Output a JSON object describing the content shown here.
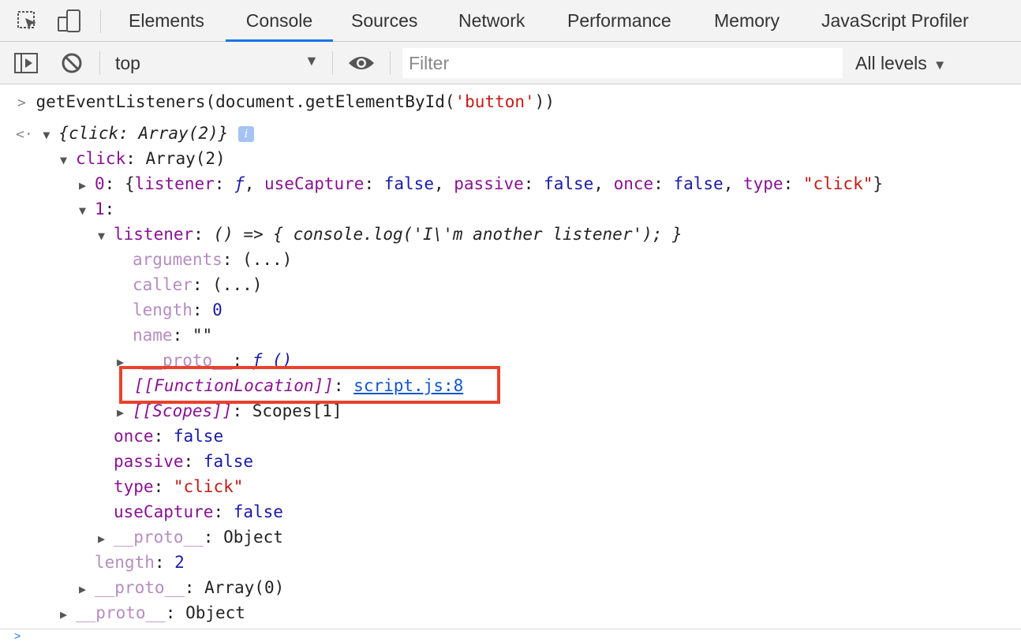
{
  "tabs": [
    {
      "label": "Elements"
    },
    {
      "label": "Console"
    },
    {
      "label": "Sources"
    },
    {
      "label": "Network"
    },
    {
      "label": "Performance"
    },
    {
      "label": "Memory"
    },
    {
      "label": "JavaScript Profiler"
    }
  ],
  "toolbar": {
    "context": "top",
    "filter_placeholder": "Filter",
    "levels": "All levels"
  },
  "console": {
    "input": {
      "fn": "getEventListeners",
      "args": "(document.getElementById(",
      "string": "'button'",
      "close": "))"
    },
    "result_summary": "{click: Array(2)}",
    "click_label": "click",
    "click_value": "Array(2)",
    "item0": {
      "index": "0",
      "open": "{",
      "listener_key": "listener",
      "listener_val": "ƒ",
      "usecapture_key": "useCapture",
      "usecapture_val": "false",
      "passive_key": "passive",
      "passive_val": "false",
      "once_key": "once",
      "once_val": "false",
      "type_key": "type",
      "type_val": "\"click\"",
      "close": "}"
    },
    "item1_index": "1",
    "listener_key": "listener",
    "listener_src": "() => { console.log('I\\'m another listener'); }",
    "fn_props": [
      {
        "key": "arguments",
        "val": "(...)"
      },
      {
        "key": "caller",
        "val": "(...)"
      },
      {
        "key": "length",
        "val": "0"
      },
      {
        "key": "name",
        "val": "\"\""
      }
    ],
    "fn_proto_key": "__proto__",
    "fn_proto_val": "ƒ ()",
    "function_location_key": "[[FunctionLocation]]",
    "function_location_link": "script.js:8",
    "scopes_key": "[[Scopes]]",
    "scopes_val": "Scopes[1]",
    "item1_props": [
      {
        "key": "once",
        "val": "false"
      },
      {
        "key": "passive",
        "val": "false"
      },
      {
        "key": "type",
        "val": "\"click\""
      },
      {
        "key": "useCapture",
        "val": "false"
      }
    ],
    "item1_proto_key": "__proto__",
    "item1_proto_val": "Object",
    "array_length_key": "length",
    "array_length_val": "2",
    "array_proto_key": "__proto__",
    "array_proto_val": "Array(0)",
    "obj_proto_key": "__proto__",
    "obj_proto_val": "Object"
  }
}
